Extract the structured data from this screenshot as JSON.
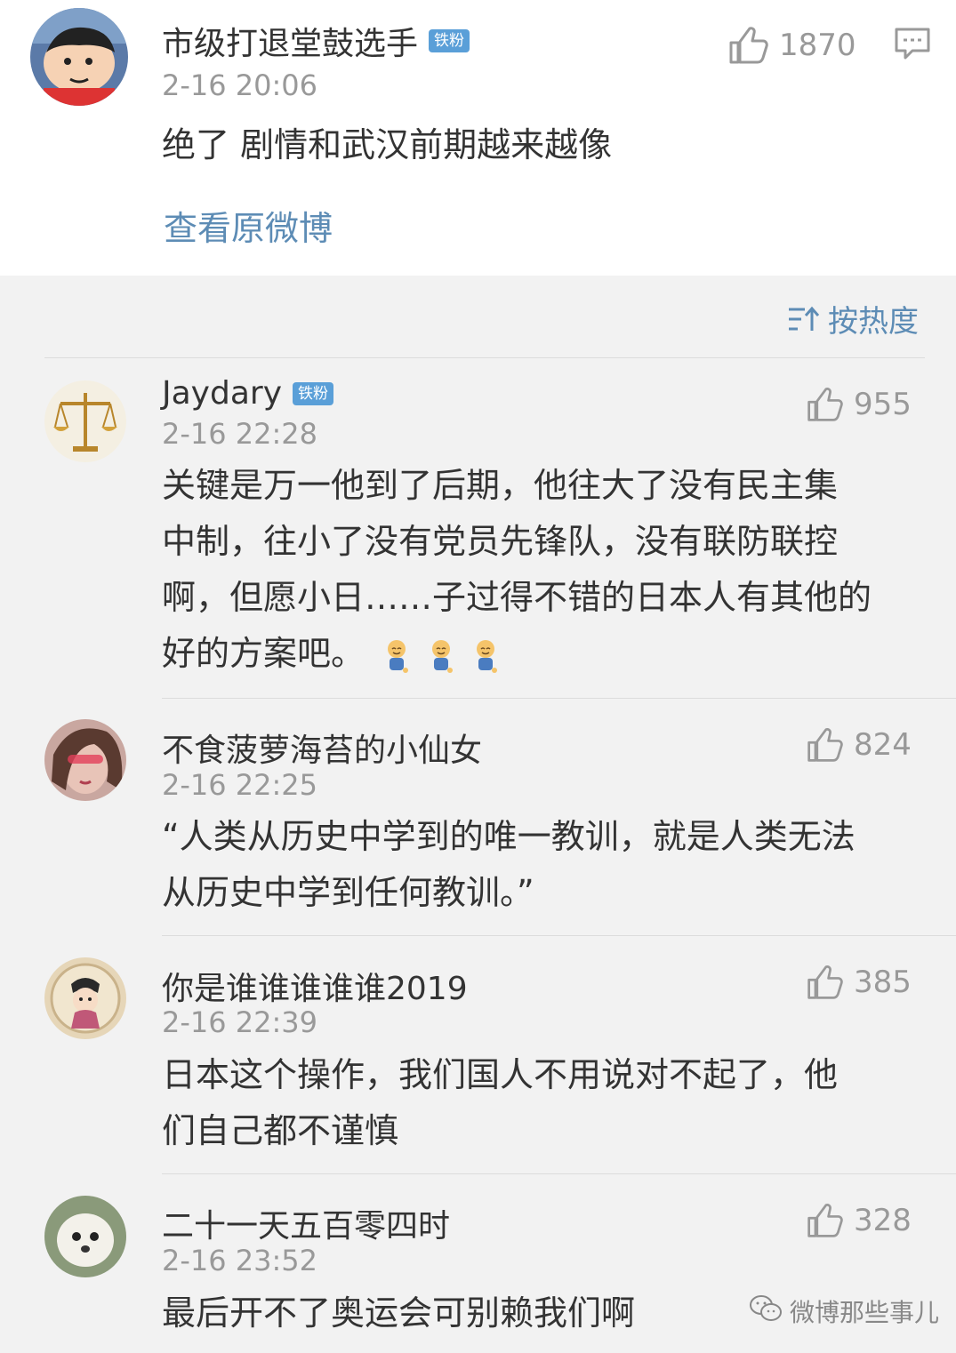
{
  "top_comment": {
    "username": "市级打退堂鼓选手",
    "badge": "铁粉",
    "time": "2-16 20:06",
    "likes": "1870",
    "text": "绝了 剧情和武汉前期越来越像",
    "view_original": "查看原微博"
  },
  "sort": {
    "label": "按热度"
  },
  "replies": [
    {
      "username": "Jaydary",
      "badge": "铁粉",
      "time": "2-16 22:28",
      "likes": "955",
      "lines": [
        "关键是万一他到了后期，他往大了没有民主集",
        "中制，往小了没有党员先锋队，没有联防联控",
        "啊，但愿小日……子过得不错的日本人有其他的",
        "好的方案吧。"
      ]
    },
    {
      "username": "不食菠萝海苔的小仙女",
      "time": "2-16 22:25",
      "likes": "824",
      "lines": [
        "“人类从历史中学到的唯一教训，就是人类无法",
        "从历史中学到任何教训。”"
      ]
    },
    {
      "username": "你是谁谁谁谁谁2019",
      "time": "2-16 22:39",
      "likes": "385",
      "lines": [
        "日本这个操作，我们国人不用说对不起了，他",
        "们自己都不谨慎"
      ]
    },
    {
      "username": "二十一天五百零四时",
      "time": "2-16 23:52",
      "likes": "328",
      "lines": [
        "最后开不了奥运会可别赖我们啊"
      ]
    }
  ],
  "watermark": "微博那些事儿",
  "colors": {
    "link": "#5d8cb5",
    "badge": "#5a9fd8",
    "muted": "#999999",
    "background": "#f2f2f2"
  }
}
